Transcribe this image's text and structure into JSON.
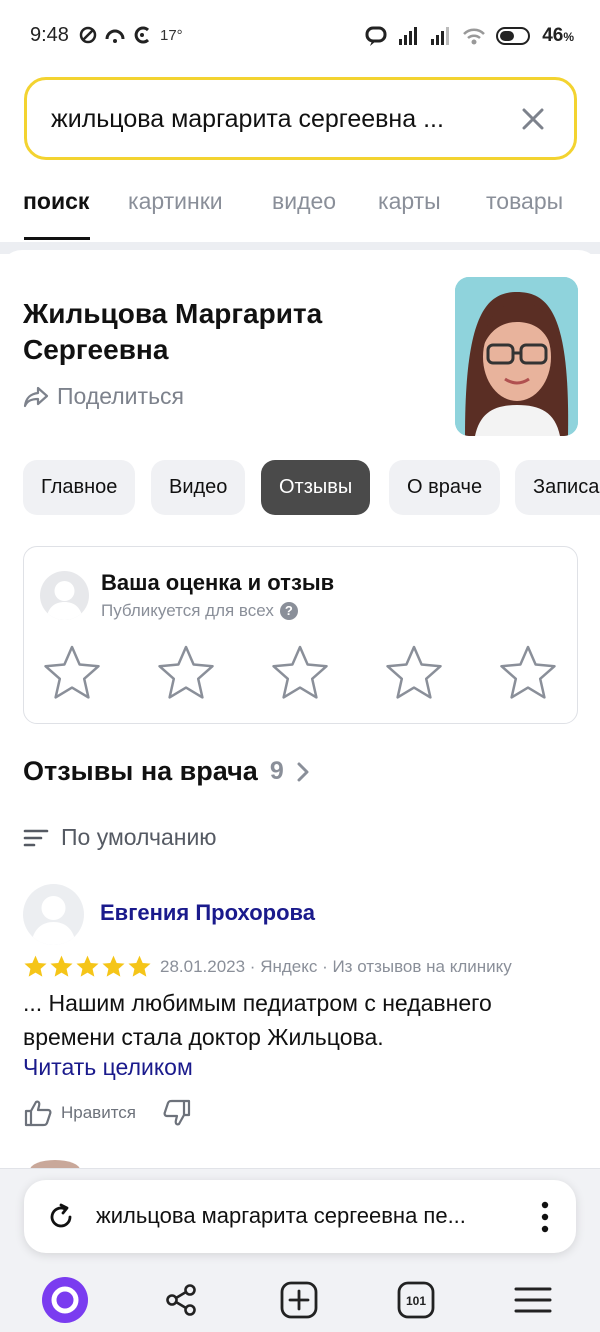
{
  "status_bar": {
    "time": "9:48",
    "temperature": "17°",
    "battery": "46",
    "battery_unit": "%"
  },
  "search": {
    "query": "жильцова маргарита сергеевна ..."
  },
  "tabs": [
    {
      "label": "поиск",
      "active": true
    },
    {
      "label": "картинки",
      "active": false
    },
    {
      "label": "видео",
      "active": false
    },
    {
      "label": "карты",
      "active": false
    },
    {
      "label": "товары",
      "active": false
    }
  ],
  "entity": {
    "name": "Жильцова Маргарита Сергеевна",
    "share_label": "Поделиться"
  },
  "chips": [
    {
      "label": "Главное",
      "active": false
    },
    {
      "label": "Видео",
      "active": false
    },
    {
      "label": "Отзывы",
      "active": true
    },
    {
      "label": "О враче",
      "active": false
    },
    {
      "label": "Записа",
      "active": false
    }
  ],
  "rate_box": {
    "title": "Ваша оценка и отзыв",
    "subtitle": "Публикуется для всех",
    "help_symbol": "?",
    "stars": 5
  },
  "reviews": {
    "heading": "Отзывы на врача",
    "count": "9",
    "sort_label": "По умолчанию",
    "items": [
      {
        "author": "Евгения Прохорова",
        "rating": 5,
        "meta": "28.01.2023 · Яндекс · Из отзывов на клинику",
        "text": "... Нашим любимым педиатром с недавнего времени стала доктор Жильцова.",
        "read_more": "Читать целиком",
        "like_label": "Нравится"
      }
    ]
  },
  "bottom_bar": {
    "query": "жильцова маргарита сергеевна пе...",
    "tabs_count": "101"
  },
  "colors": {
    "search_border": "#f3d330",
    "link": "#1a1a8c",
    "star_filled": "#f5c518",
    "alice": "#7a3cf0"
  }
}
